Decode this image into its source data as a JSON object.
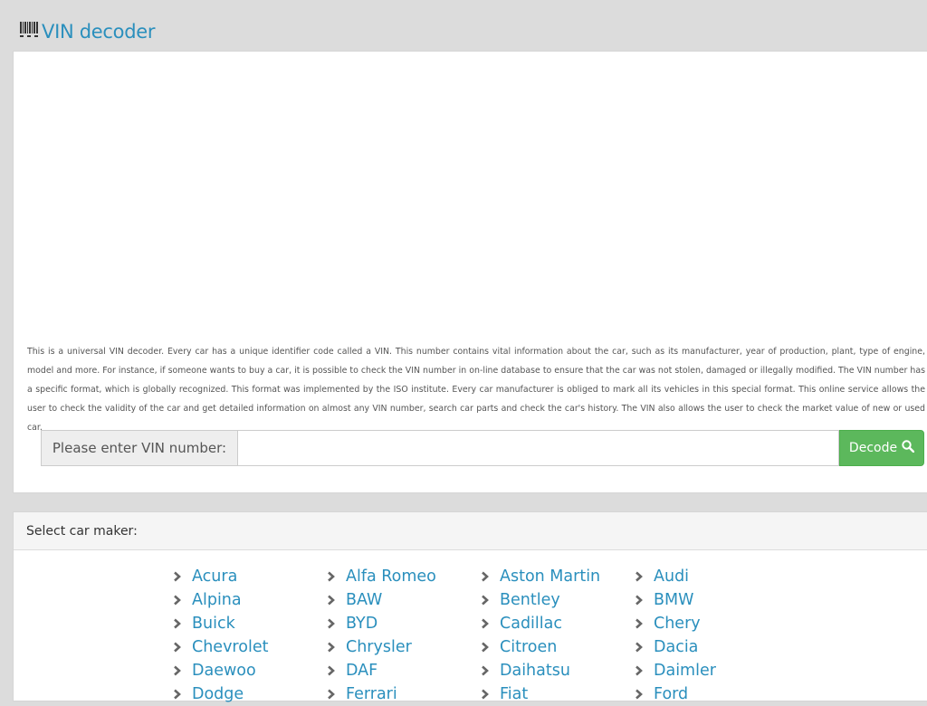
{
  "header": {
    "title": "VIN decoder",
    "icon": "barcode-icon"
  },
  "intro_text": "This is a universal VIN decoder. Every car has a unique identifier code called a VIN. This number contains vital information about the car, such as its manufacturer, year of production, plant, type of engine, model and more. For instance, if someone wants to buy a car, it is possible to check the VIN number in on-line database to ensure that the car was not stolen, damaged or illegally modified. The VIN number has a specific format, which is globally recognized. This format was implemented by the ISO institute. Every car manufacturer is obliged to mark all its vehicles in this special format. This online service allows the user to check the validity of the car and get detailed information on almost any VIN number, search car parts and check the car's history. The VIN also allows the user to check the market value of new or used car.",
  "vin_form": {
    "label": "Please enter VIN number:",
    "value": "",
    "button_label": "Decode",
    "button_icon": "search-icon",
    "button_color": "#5cb85c"
  },
  "makers_panel": {
    "heading": "Select car maker:",
    "makers": [
      "Acura",
      "Alfa Romeo",
      "Aston Martin",
      "Audi",
      "Alpina",
      "BAW",
      "Bentley",
      "BMW",
      "Buick",
      "BYD",
      "Cadillac",
      "Chery",
      "Chevrolet",
      "Chrysler",
      "Citroen",
      "Dacia",
      "Daewoo",
      "DAF",
      "Daihatsu",
      "Daimler",
      "Dodge",
      "Ferrari",
      "Fiat",
      "Ford"
    ]
  },
  "colors": {
    "link": "#2a8fbd",
    "background": "#dcdcdc"
  }
}
